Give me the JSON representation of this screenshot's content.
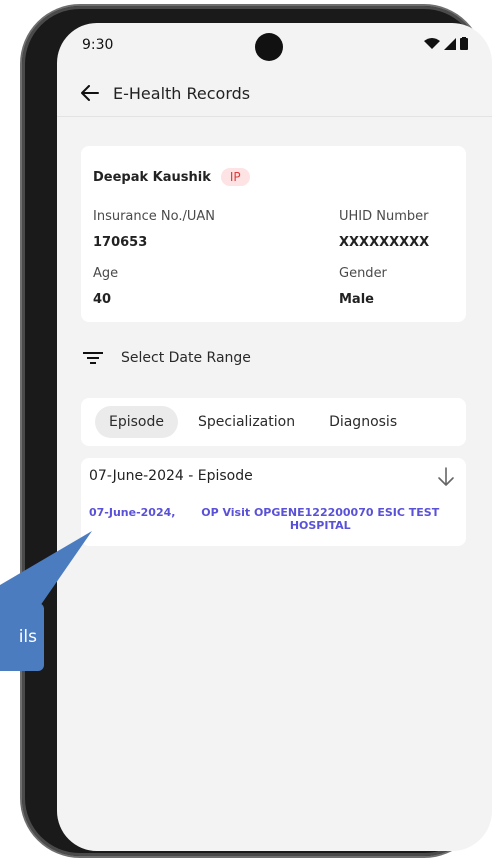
{
  "status_bar": {
    "time": "9:30"
  },
  "header": {
    "title": "E-Health Records"
  },
  "patient": {
    "name": "Deepak Kaushik",
    "badge": "IP",
    "insurance_label": "Insurance No./UAN",
    "insurance_value": "170653",
    "uhid_label": "UHID Number",
    "uhid_value": "XXXXXXXXX",
    "age_label": "Age",
    "age_value": "40",
    "gender_label": "Gender",
    "gender_value": "Male"
  },
  "filter": {
    "label": "Select Date Range"
  },
  "tabs": [
    {
      "label": "Episode",
      "active": true
    },
    {
      "label": "Specialization",
      "active": false
    },
    {
      "label": "Diagnosis",
      "active": false
    }
  ],
  "episode": {
    "title": "07-June-2024 - Episode",
    "visit_date": "07-June-2024,",
    "visit_desc": "OP Visit OPGENE122200070 ESIC TEST HOSPITAL"
  },
  "callout": {
    "text": "ils"
  },
  "colors": {
    "accent_link": "#5a52d6",
    "badge_bg": "#fde3e3",
    "badge_text": "#e03a3a",
    "callout": "#4c7cc0"
  }
}
